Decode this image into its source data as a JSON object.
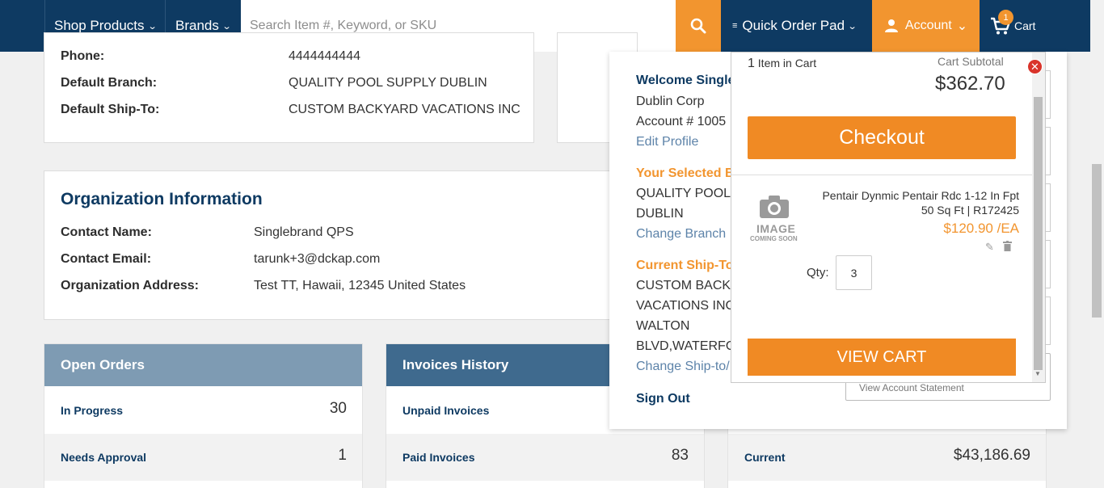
{
  "nav": {
    "shop_products": "Shop Products",
    "brands": "Brands",
    "search_placeholder": "Search Item #, Keyword, or SKU",
    "quick_order_pad": "Quick Order Pad",
    "account": "Account",
    "cart": "Cart",
    "cart_count": "1"
  },
  "profile": {
    "phone_label": "Phone:",
    "phone_value": "4444444444",
    "branch_label": "Default Branch:",
    "branch_value": "QUALITY POOL SUPPLY DUBLIN",
    "shipto_label": "Default Ship-To:",
    "shipto_value": "CUSTOM BACKYARD VACATIONS INC"
  },
  "organization": {
    "title": "Organization Information",
    "contact_name_label": "Contact Name:",
    "contact_name_value": "Singlebrand QPS",
    "contact_email_label": "Contact Email:",
    "contact_email_value": "tarunk+3@dckap.com",
    "address_label": "Organization Address:",
    "address_value": "Test TT, Hawaii, 12345 United States"
  },
  "open_orders": {
    "title": "Open Orders",
    "rows": [
      {
        "label": "In Progress",
        "value": "30"
      },
      {
        "label": "Needs Approval",
        "value": "1"
      }
    ]
  },
  "invoices": {
    "title": "Invoices History",
    "rows": [
      {
        "label": "Unpaid Invoices",
        "value": ""
      },
      {
        "label": "Paid Invoices",
        "value": "83"
      }
    ]
  },
  "account_panel": {
    "current_label": "Current",
    "current_value": "$43,186.69",
    "view_statement": "View Account Statement"
  },
  "account_dropdown": {
    "welcome": "Welcome Single",
    "company": "Dublin Corp",
    "account_no": "Account # 1005",
    "edit_profile": "Edit Profile",
    "selected_branch_title": "Your Selected B",
    "branch_line1": "QUALITY POOL",
    "branch_line2": "DUBLIN",
    "change_branch": "Change Branch",
    "shipto_title": "Current Ship-To",
    "shipto_line1": "CUSTOM BACKY",
    "shipto_line2": "VACATIONS INC,",
    "shipto_line3": "WALTON",
    "shipto_line4": "BLVD,WATERFOR",
    "change_shipto": "Change Ship-to/",
    "sign_out": "Sign Out"
  },
  "minicart": {
    "items_count": "1",
    "items_label": "Item in Cart",
    "subtotal_label": "Cart Subtotal",
    "subtotal_value": "$362.70",
    "checkout": "Checkout",
    "product_line1": "Pentair Dynmic Pentair Rdc 1-12 In Fpt",
    "product_line2": "50 Sq Ft | R172425",
    "price": "$120.90 /EA",
    "qty_label": "Qty:",
    "qty_value": "3",
    "image_text1": "IMAGE",
    "image_text2": "COMING SOON",
    "view_cart": "VIEW CART"
  },
  "colors": {
    "navy": "#0e3a62",
    "orange": "#f2952f",
    "open_orders_header": "#7e9bb3",
    "invoices_header": "#3f6a8e"
  }
}
